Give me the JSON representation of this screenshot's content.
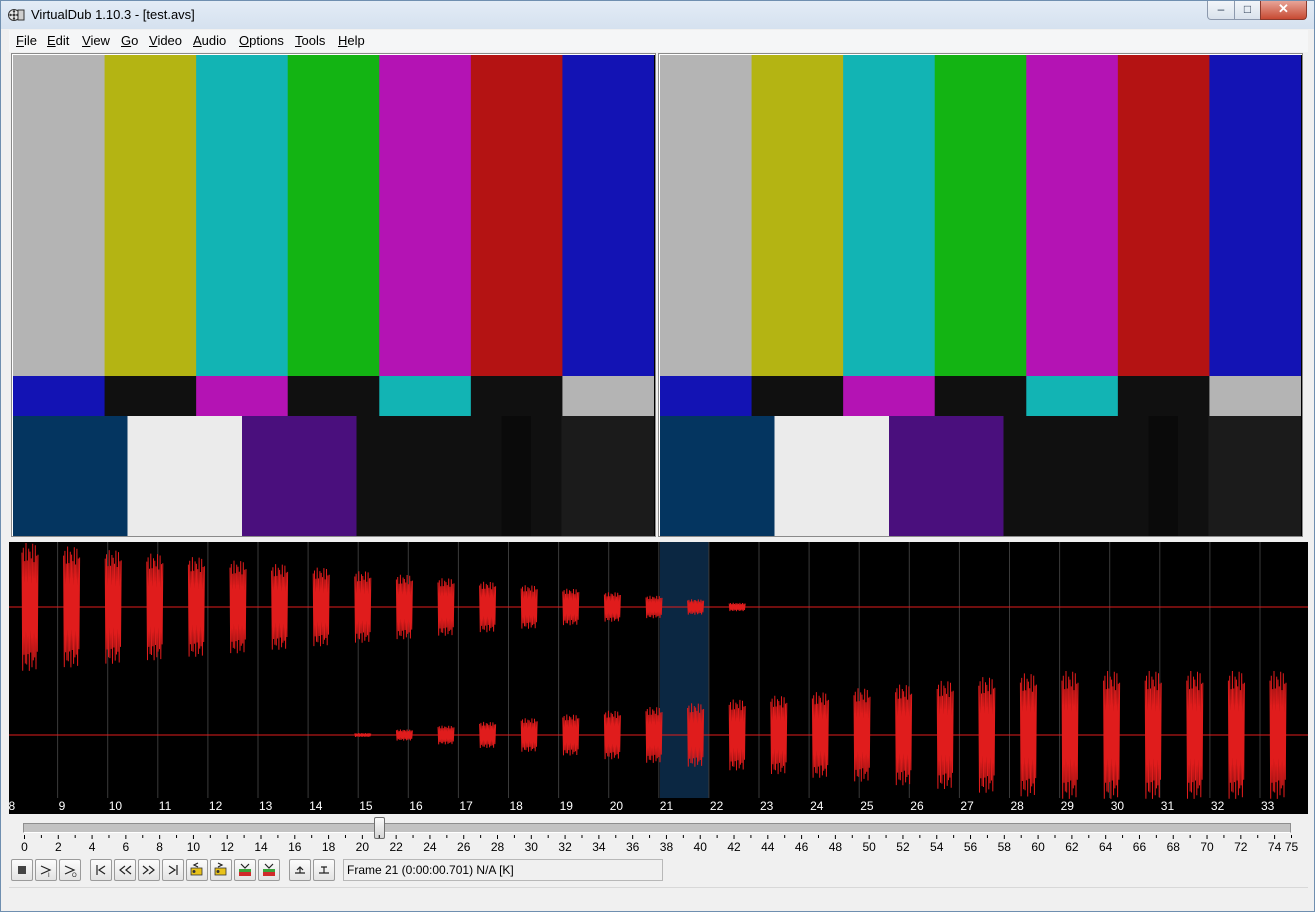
{
  "window": {
    "title": "VirtualDub 1.10.3 - [test.avs]",
    "icon": "virtualdub-film-icon",
    "controls": {
      "minimize": "–",
      "maximize": "□",
      "close": "✕"
    }
  },
  "menu": {
    "items": [
      {
        "label": "File",
        "accel": "F"
      },
      {
        "label": "Edit",
        "accel": "E"
      },
      {
        "label": "View",
        "accel": "V"
      },
      {
        "label": "Go",
        "accel": "G"
      },
      {
        "label": "Video",
        "accel": "V"
      },
      {
        "label": "Audio",
        "accel": "A"
      },
      {
        "label": "Options",
        "accel": "O"
      },
      {
        "label": "Tools",
        "accel": "T"
      },
      {
        "label": "Help",
        "accel": "H"
      }
    ]
  },
  "panes": {
    "input": "input-video-pane",
    "output": "output-video-pane",
    "top_bars": [
      "#b4b4b4",
      "#b4b413",
      "#12b4b4",
      "#13b413",
      "#b413b4",
      "#b41313",
      "#1313b4"
    ],
    "mid_bars": [
      "#1313b4",
      "#101010",
      "#b413b4",
      "#101010",
      "#12b4b4",
      "#101010",
      "#b4b4b4"
    ],
    "bottom_blocks": [
      "#043560",
      "#ebebeb",
      "#4a0f7d",
      "#101010",
      "#101010",
      "#0a0a0a",
      "#101010",
      "#1b1b1b",
      "#101010"
    ]
  },
  "audio": {
    "frame_labels": [
      "8",
      "9",
      "10",
      "11",
      "12",
      "13",
      "14",
      "15",
      "16",
      "17",
      "18",
      "19",
      "20",
      "21",
      "22",
      "23",
      "24",
      "25",
      "26",
      "27",
      "28",
      "29",
      "30",
      "31",
      "32",
      "33"
    ],
    "current_frame": 21,
    "waveform_color": "#e01c1c",
    "highlight_color": "#0b2742"
  },
  "timeline": {
    "position": 21,
    "max": 75,
    "tick_labels": [
      "0",
      "2",
      "4",
      "6",
      "8",
      "10",
      "12",
      "14",
      "16",
      "18",
      "20",
      "22",
      "24",
      "26",
      "28",
      "30",
      "32",
      "34",
      "36",
      "38",
      "40",
      "42",
      "44",
      "46",
      "48",
      "50",
      "52",
      "54",
      "56",
      "58",
      "60",
      "62",
      "64",
      "66",
      "68",
      "70",
      "72",
      "74",
      "75"
    ]
  },
  "toolbar": {
    "buttons": [
      "stop-icon",
      "play-input-icon",
      "play-output-icon",
      "go-start-icon",
      "step-back-icon",
      "step-forward-icon",
      "go-end-icon",
      "prev-key-icon",
      "next-key-icon",
      "scene-back-icon",
      "scene-forward-icon",
      "mark-in-icon",
      "mark-out-icon"
    ],
    "frame_status": "Frame 21 (0:00:00.701) N/A [K]"
  }
}
